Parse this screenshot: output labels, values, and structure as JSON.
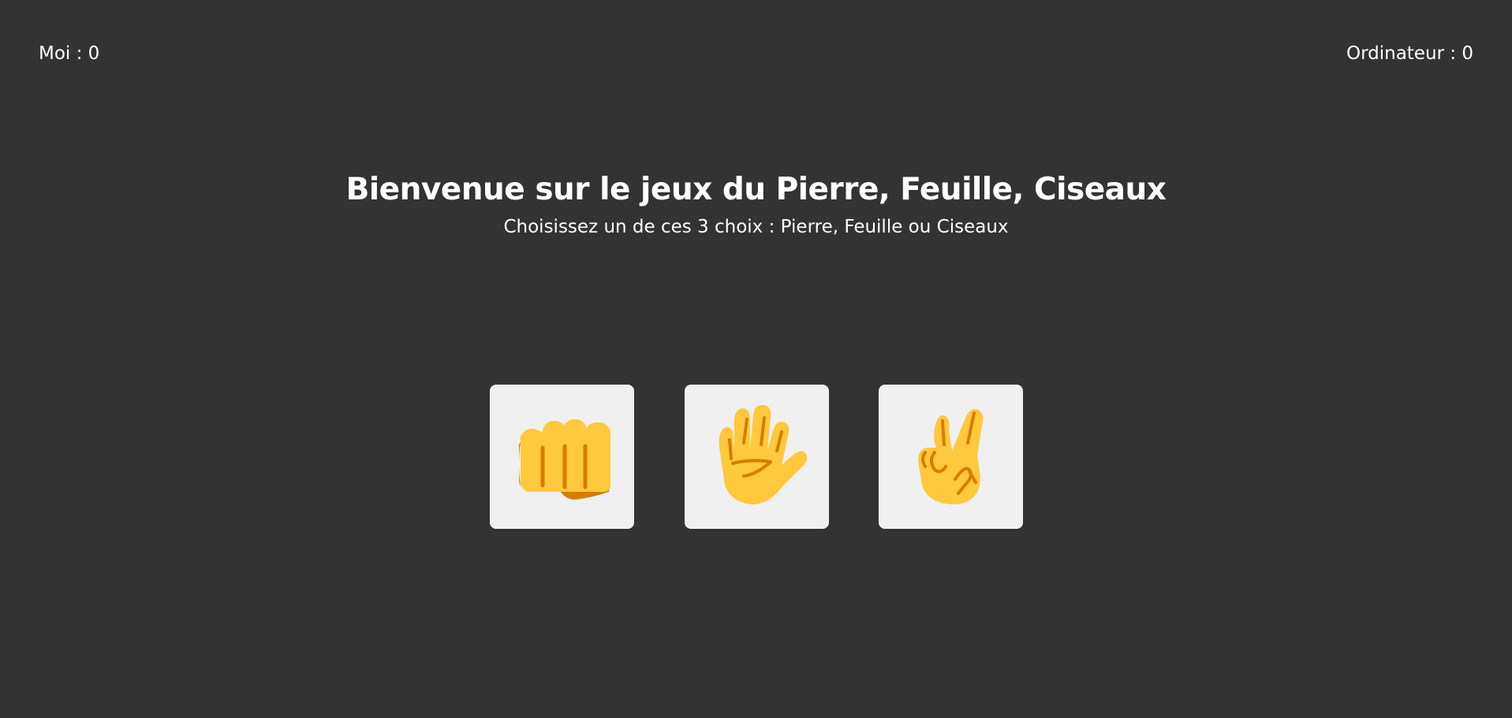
{
  "scoreboard": {
    "player_label": "Moi : 0",
    "computer_label": "Ordinateur : 0"
  },
  "header": {
    "title": "Bienvenue sur le jeux du Pierre, Feuille, Ciseaux",
    "subtitle": "Choisissez un de ces 3 choix : Pierre, Feuille ou Ciseaux"
  },
  "choices": [
    {
      "name": "Pierre",
      "icon": "raised-fist-icon"
    },
    {
      "name": "Feuille",
      "icon": "raised-hand-icon"
    },
    {
      "name": "Ciseaux",
      "icon": "victory-hand-icon"
    }
  ],
  "colors": {
    "background": "#333333",
    "text": "#ffffff",
    "card": "#f0f0f0",
    "emoji_yellow": "#FFC83D",
    "emoji_shadow": "#D67D00"
  }
}
